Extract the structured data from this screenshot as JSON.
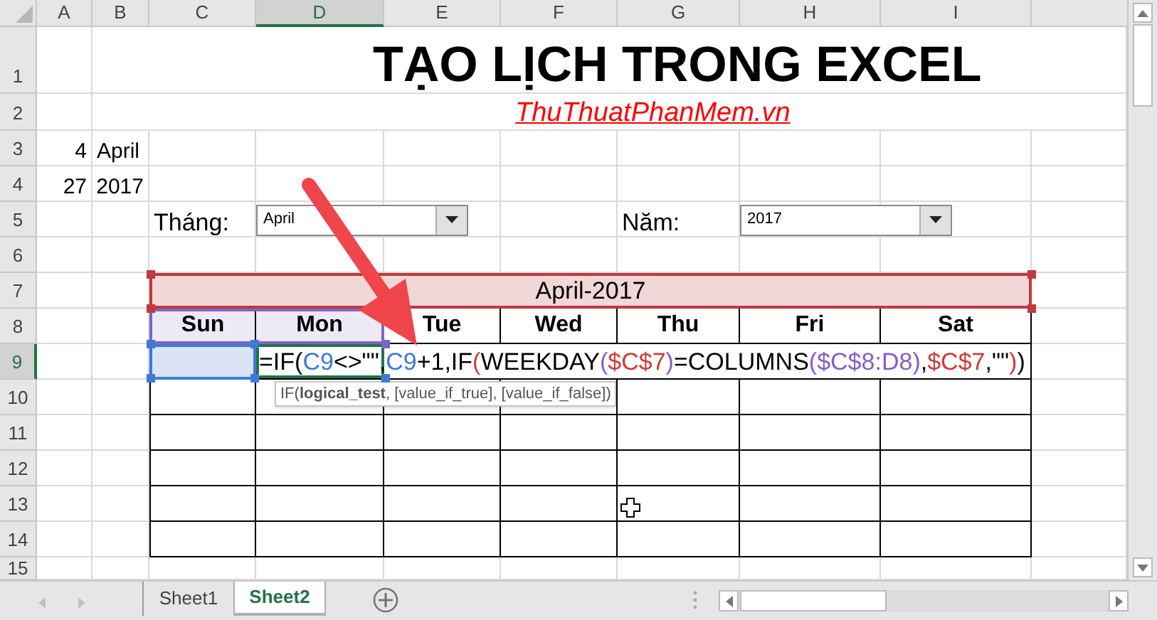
{
  "column_headers": [
    {
      "label": "A",
      "selected": false
    },
    {
      "label": "B",
      "selected": false
    },
    {
      "label": "C",
      "selected": false
    },
    {
      "label": "D",
      "selected": true
    },
    {
      "label": "E",
      "selected": false
    },
    {
      "label": "F",
      "selected": false
    },
    {
      "label": "G",
      "selected": false
    },
    {
      "label": "H",
      "selected": false
    },
    {
      "label": "I",
      "selected": false
    }
  ],
  "row_headers": [
    {
      "label": "1",
      "selected": false
    },
    {
      "label": "2",
      "selected": false
    },
    {
      "label": "3",
      "selected": false
    },
    {
      "label": "4",
      "selected": false
    },
    {
      "label": "5",
      "selected": false
    },
    {
      "label": "6",
      "selected": false
    },
    {
      "label": "7",
      "selected": false
    },
    {
      "label": "8",
      "selected": false
    },
    {
      "label": "9",
      "selected": true
    },
    {
      "label": "10",
      "selected": false
    },
    {
      "label": "11",
      "selected": false
    },
    {
      "label": "12",
      "selected": false
    },
    {
      "label": "13",
      "selected": false
    },
    {
      "label": "14",
      "selected": false
    },
    {
      "label": "15",
      "selected": false
    }
  ],
  "title": "TẠO LỊCH TRONG EXCEL",
  "link": "ThuThuatPhanMem.vn",
  "cells": [
    "4",
    "April",
    "27",
    "2017"
  ],
  "month_label": "Tháng:",
  "month_dropdown": {
    "value": "April"
  },
  "year_label": "Năm:",
  "year_dropdown": {
    "value": "2017"
  },
  "calendar": {
    "title": "April-2017",
    "days": [
      {
        "label": "Sun",
        "selected": true
      },
      {
        "label": "Mon",
        "selected": true
      },
      {
        "label": "Tue",
        "selected": false
      },
      {
        "label": "Wed",
        "selected": false
      },
      {
        "label": "Thu",
        "selected": false
      },
      {
        "label": "Fri",
        "selected": false
      },
      {
        "label": "Sat",
        "selected": false
      }
    ]
  },
  "formula": [
    {
      "text": "=IF(",
      "color": "#000000"
    },
    {
      "text": "C9",
      "color": "#3d7ad6"
    },
    {
      "text": "<>\"\",",
      "color": "#000000"
    },
    {
      "text": "C9",
      "color": "#3d7ad6"
    },
    {
      "text": "+1,IF",
      "color": "#000000"
    },
    {
      "text": "(",
      "color": "#d03a3a"
    },
    {
      "text": "WEEKDAY",
      "color": "#000000"
    },
    {
      "text": "(",
      "color": "#8a5cc8"
    },
    {
      "text": "$C$7",
      "color": "#d03a3a"
    },
    {
      "text": ")",
      "color": "#8a5cc8"
    },
    {
      "text": "=COLUMNS",
      "color": "#000000"
    },
    {
      "text": "(",
      "color": "#8a5cc8"
    },
    {
      "text": "$C$8:D8",
      "color": "#8a5cc8"
    },
    {
      "text": ")",
      "color": "#8a5cc8"
    },
    {
      "text": ",",
      "color": "#000000"
    },
    {
      "text": "$C$7",
      "color": "#d03a3a"
    },
    {
      "text": ",\"\"",
      "color": "#000000"
    },
    {
      "text": ")",
      "color": "#d03a3a"
    },
    {
      "text": ")",
      "color": "#000000"
    }
  ],
  "tooltip": "IF(**logical_test**, [value_if_true], [value_if_false])",
  "sheet_tabs": [
    {
      "label": "Sheet1",
      "selected": false
    },
    {
      "label": "Sheet2",
      "selected": true
    }
  ]
}
